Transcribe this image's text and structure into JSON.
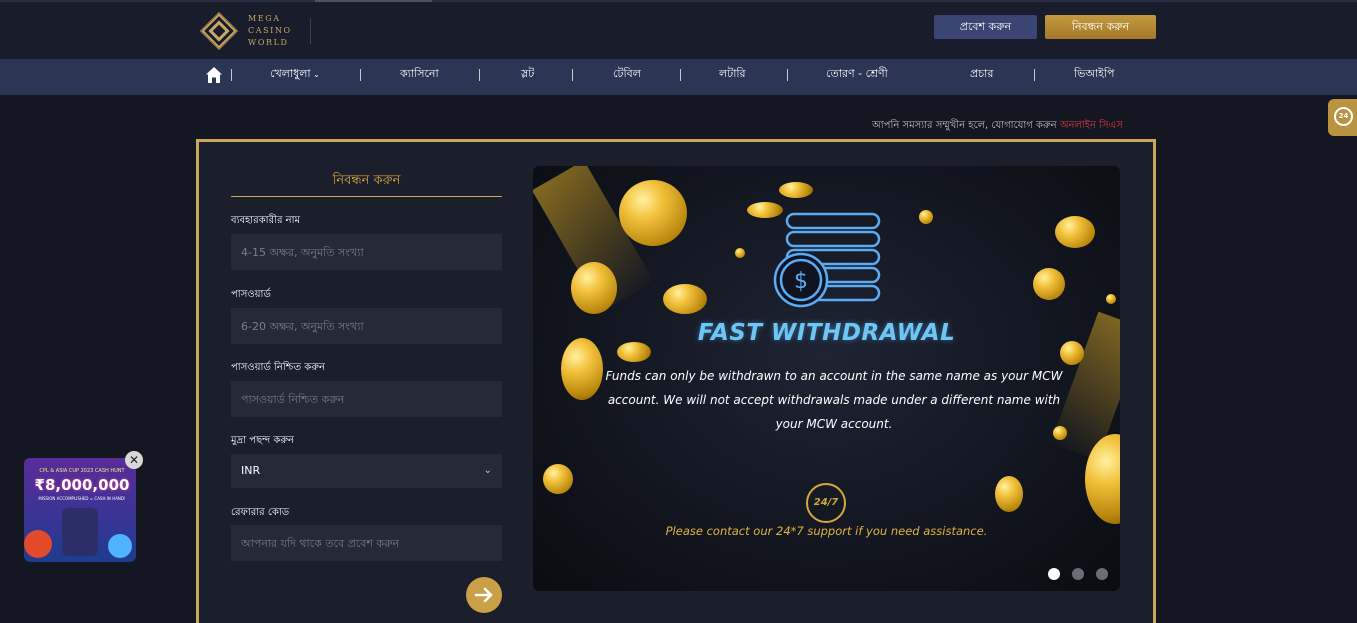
{
  "header": {
    "logo_lines": [
      "MEGA",
      "CASINO",
      "WORLD"
    ],
    "login_label": "প্রবেশ করুন",
    "register_label": "নিবন্ধন করুন"
  },
  "nav": {
    "items": [
      "খেলাধুলা",
      "ক্যাসিনো",
      "স্লট",
      "টেবিল",
      "লটারি",
      "তোরণ - শ্রেণী",
      "প্রচার",
      "ভিআইপি"
    ]
  },
  "support": {
    "text": "আপনি সমস্যার সম্মুখীন হলে, যোগাযোগ করুন",
    "link": "অনলাইন সিএস",
    "badge": "24"
  },
  "form": {
    "title": "নিবন্ধন করুন",
    "username": {
      "label": "ব্যবহারকারীর নাম",
      "placeholder": "4-15 অক্ষর, অনুমতি সংখ্যা",
      "value": ""
    },
    "password": {
      "label": "পাসওয়ার্ড",
      "placeholder": "6-20 অক্ষর, অনুমতি সংখ্যা",
      "value": ""
    },
    "confirm": {
      "label": "পাসওয়ার্ড নিশ্চিত করুন",
      "placeholder": "পাসওয়ার্ড নিশ্চিত করুন",
      "value": ""
    },
    "currency": {
      "label": "মুদ্রা পছন্দ করুন",
      "value": "INR"
    },
    "referral": {
      "label": "রেফারার কোড",
      "placeholder": "আপনার যদি থাকে তবে প্রবেশ করুন",
      "value": ""
    }
  },
  "banner": {
    "heading": "FAST WITHDRAWAL",
    "body": "Funds can only be withdrawn to an account in the same name as your MCW account. We will not accept withdrawals made under a different name with your MCW account.",
    "support_badge": "24/7",
    "support_text": "Please contact our 24*7 support if you need assistance.",
    "slide_count": 3,
    "active_slide": 0
  },
  "promo": {
    "title": "CPL & ASIA CUP 2023 CASH HUNT",
    "amount": "₹8,000,000",
    "tagline": "MISSION ACCOMPLISHED = CASH IN HAND!"
  },
  "colors": {
    "gold": "#c9a85a",
    "nav_bg": "#2b3554",
    "login_bg": "#3a4573",
    "link_red": "#e03a3a",
    "banner_blue": "#6ec6f5"
  }
}
